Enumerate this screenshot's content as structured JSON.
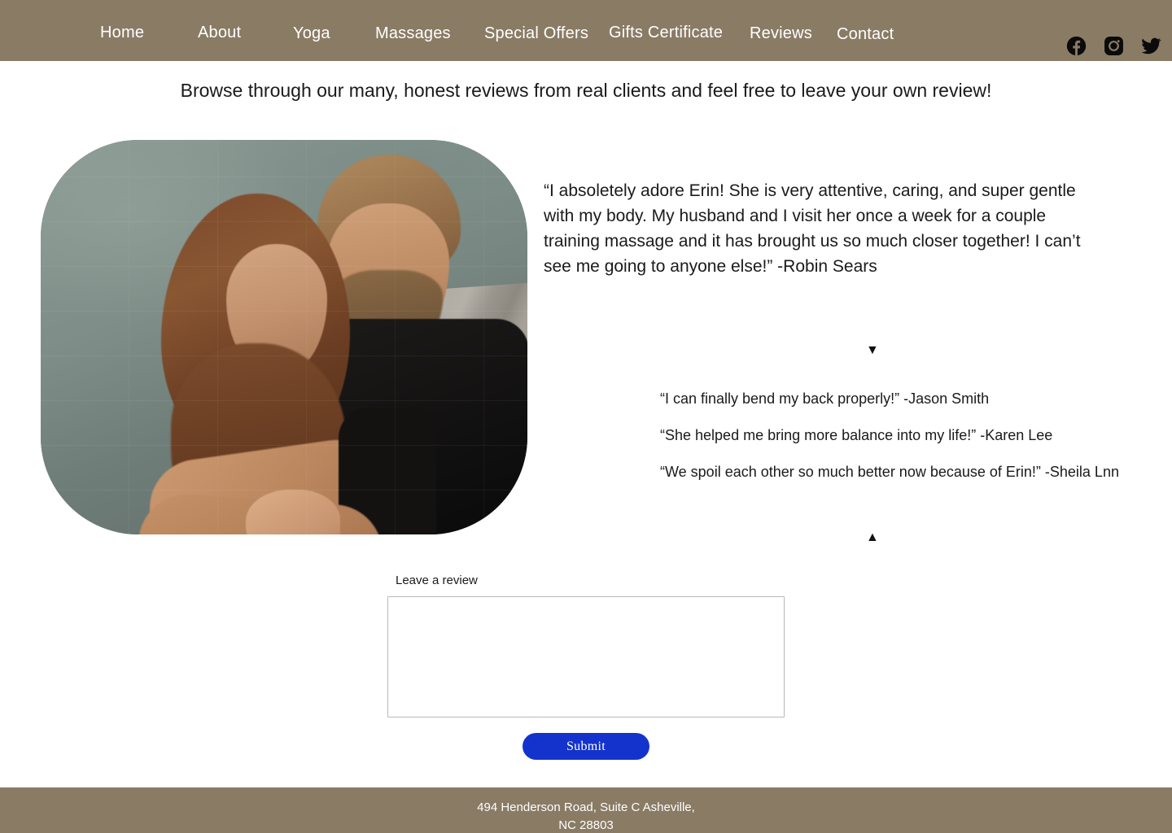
{
  "nav": {
    "background_color": "#8a7b65",
    "items": [
      {
        "label": "Home"
      },
      {
        "label": "About"
      },
      {
        "label": "Yoga"
      },
      {
        "label": "Massages"
      },
      {
        "label": "Special Offers"
      },
      {
        "label": "Gifts Certificate"
      },
      {
        "label": "Reviews"
      },
      {
        "label": "Contact"
      }
    ],
    "social": [
      {
        "name": "facebook-icon"
      },
      {
        "name": "instagram-icon"
      },
      {
        "name": "twitter-icon"
      }
    ]
  },
  "main": {
    "intro_heading": "Browse through our many, honest reviews from real clients and feel free to leave your own review!",
    "featured_review": "“I absoletely adore Erin! She is very attentive, caring, and super gentle with my body. My husband and I visit her once a week for a couple training massage and it has brought us so much closer together! I can’t see me going to anyone else!” -Robin Sears",
    "arrow_down": "▼",
    "arrow_up": "▲",
    "quotes": [
      "“I can finally bend my back properly!”  -Jason Smith",
      "“She helped me bring more balance into my life!” -Karen Lee",
      "“We spoil each other so much better now because of Erin!”  -Sheila Lnn"
    ]
  },
  "form": {
    "label": "Leave a review",
    "value": "",
    "placeholder": "",
    "submit_label": "Submit",
    "submit_color": "#1433cc"
  },
  "footer": {
    "background_color": "#8a7b65",
    "address_line1": "494 Henderson Road, Suite C Asheville,",
    "address_line2": "NC 28803"
  }
}
